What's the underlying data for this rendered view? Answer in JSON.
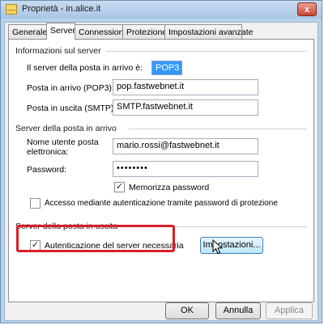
{
  "window": {
    "title": "Proprietà - in.alice.it",
    "close_glyph": "x"
  },
  "tabs": [
    {
      "label": "Generale",
      "active": false
    },
    {
      "label": "Server",
      "active": true
    },
    {
      "label": "Connessione",
      "active": false
    },
    {
      "label": "Protezione",
      "active": false
    },
    {
      "label": "Impostazioni avanzate",
      "active": false
    }
  ],
  "server_info": {
    "section_title": "Informazioni sul server",
    "incoming_type_label": "Il server della posta in arrivo è:",
    "incoming_type_value": "POP3",
    "incoming_label": "Posta in arrivo (POP3):",
    "incoming_value": "pop.fastwebnet.it",
    "outgoing_label": "Posta in uscita (SMTP):",
    "outgoing_value": "SMTP.fastwebnet.it"
  },
  "incoming_server": {
    "section_title": "Server della posta in arrivo",
    "username_label_line1": "Nome utente posta",
    "username_label_line2": "elettronica:",
    "username_value": "mario.rossi@fastwebnet.it",
    "password_label": "Password:",
    "password_value": "••••••••",
    "remember_password_label": "Memorizza password",
    "remember_password_checked": true,
    "spa_label": "Accesso mediante autenticazione tramite password di protezione",
    "spa_checked": false
  },
  "outgoing_server": {
    "section_title": "Server della posta in uscita",
    "auth_label": "Autenticazione del server necessaria",
    "auth_checked": true,
    "settings_button": "Impostazioni..."
  },
  "buttons": {
    "ok": "OK",
    "cancel": "Annulla",
    "apply": "Applica"
  },
  "check_glyph": "✓",
  "colors": {
    "highlight": "#d6202a",
    "selection": "#3399ff"
  }
}
